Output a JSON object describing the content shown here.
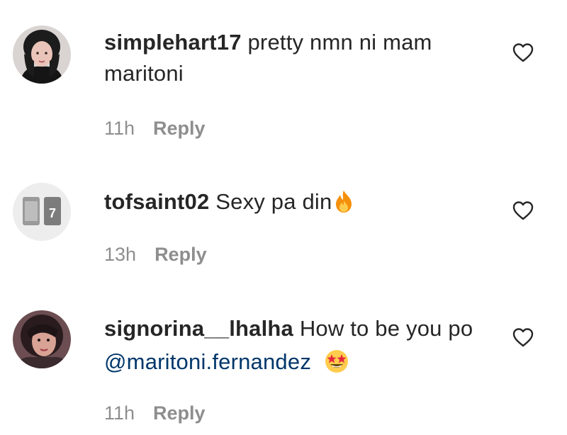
{
  "comments": [
    {
      "username": "simplehart17",
      "text": "pretty nmn ni mam maritoni",
      "time": "11h",
      "reply_label": "Reply",
      "avatar_icon": "user-avatar-photo"
    },
    {
      "username": "tofsaint02",
      "text": "Sexy pa din",
      "emoji": "fire-emoji",
      "time": "13h",
      "reply_label": "Reply",
      "avatar_icon": "jersey-avatar-photo"
    },
    {
      "username": "signorina__lhalha",
      "text_before": "How to be you po",
      "mention": "@maritoni.fernandez",
      "emoji": "star-struck-emoji",
      "time": "11h",
      "reply_label": "Reply",
      "avatar_icon": "user-avatar-photo"
    }
  ],
  "icons": {
    "like": "heart-outline-icon"
  },
  "colors": {
    "text": "#262626",
    "meta": "#8e8e8e",
    "mention": "#00376b"
  }
}
